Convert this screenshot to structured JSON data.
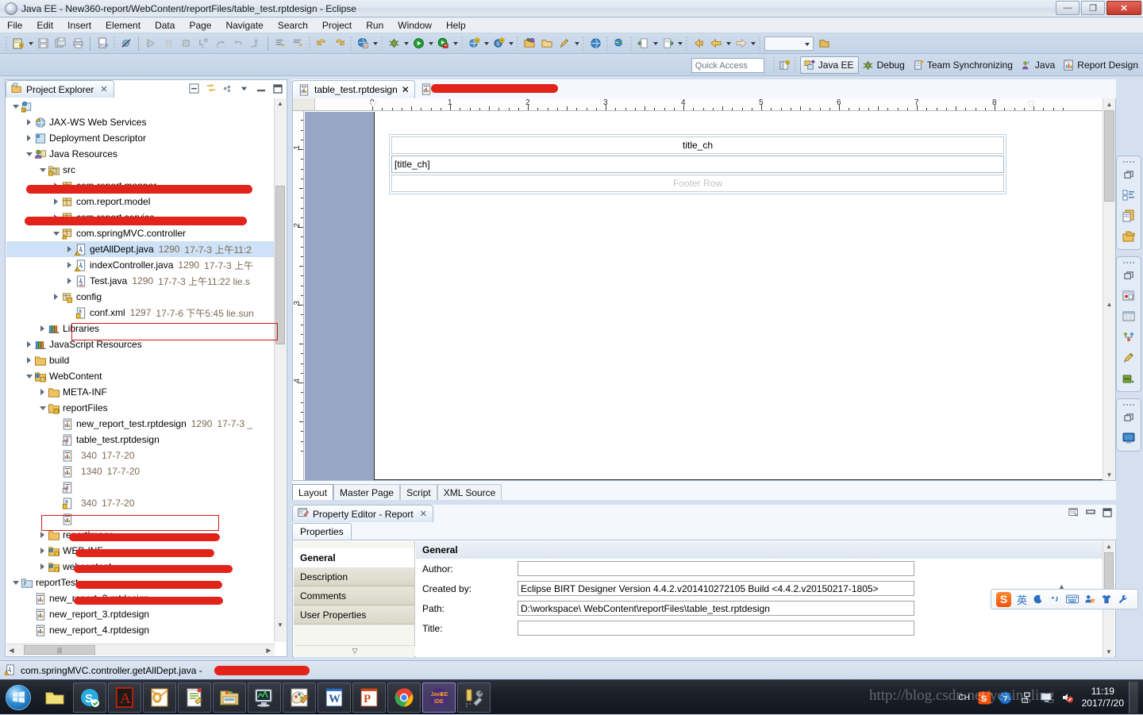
{
  "window": {
    "title": "Java EE - New360-report/WebContent/reportFiles/table_test.rptdesign - Eclipse",
    "minimize_label": "—",
    "restore_label": "❐",
    "close_label": "✕"
  },
  "menubar": {
    "items": [
      "File",
      "Edit",
      "Insert",
      "Element",
      "Data",
      "Page",
      "Navigate",
      "Search",
      "Project",
      "Run",
      "Window",
      "Help"
    ]
  },
  "toolbar": {
    "icons": [
      "new-wizard-icon",
      "save-icon",
      "save-all-icon",
      "print-icon",
      "binary-file-icon",
      "skip-breakpoints-icon",
      "run-icon",
      "suspend-icon",
      "terminate-icon",
      "step-into-icon",
      "step-over-icon",
      "step-return-icon",
      "drop-to-frame-icon",
      "next-annotation-icon",
      "previous-annotation-icon",
      "back-icon",
      "forward-icon",
      "open-web-browser-icon",
      "debug-icon",
      "run-as-icon",
      "run-server-icon",
      "new-web-project-icon",
      "new-server-icon",
      "open-type-icon",
      "open-task-icon",
      "new-report-icon",
      "publish-icon",
      "launch-icon",
      "export-icon",
      "import-icon",
      "previous-edit-icon",
      "back-nav-icon",
      "forward-nav-icon"
    ]
  },
  "perspective_bar": {
    "quick_access_placeholder": "Quick Access",
    "open_perspective_icon": "open-perspective-icon",
    "items": [
      {
        "label": "Java EE",
        "icon": "java-ee-perspective-icon",
        "active": true
      },
      {
        "label": "Debug",
        "icon": "debug-perspective-icon",
        "active": false
      },
      {
        "label": "Team Synchronizing",
        "icon": "team-sync-perspective-icon",
        "active": false
      },
      {
        "label": "Java",
        "icon": "java-perspective-icon",
        "active": false
      },
      {
        "label": "Report Design",
        "icon": "report-design-perspective-icon",
        "active": false
      }
    ]
  },
  "project_explorer": {
    "tab_label": "Project Explorer",
    "close_label": "✕",
    "tools": [
      "collapse-all-icon",
      "link-with-editor-icon",
      "view-menu-icon",
      "minimize-icon",
      "maximize-icon"
    ],
    "tree": [
      {
        "indent": 0,
        "twist": "open",
        "icon": "web-project-icon",
        "label": "",
        "meta": "",
        "meta2": "",
        "redacted": true
      },
      {
        "indent": 1,
        "twist": "closed",
        "icon": "jaxws-icon",
        "label": "JAX-WS Web Services",
        "meta": "",
        "meta2": ""
      },
      {
        "indent": 1,
        "twist": "closed",
        "icon": "deployment-icon",
        "label": "Deployment Descriptor",
        "meta": "",
        "meta2": "",
        "redacted": true
      },
      {
        "indent": 1,
        "twist": "open",
        "icon": "java-resources-icon",
        "label": "Java Resources",
        "meta": "",
        "meta2": ""
      },
      {
        "indent": 2,
        "twist": "open",
        "icon": "source-folder-icon",
        "label": "src",
        "meta": "",
        "meta2": ""
      },
      {
        "indent": 3,
        "twist": "closed",
        "icon": "package-icon",
        "label": "com.report.mapper",
        "meta": "",
        "meta2": ""
      },
      {
        "indent": 3,
        "twist": "closed",
        "icon": "package-icon",
        "label": "com.report.model",
        "meta": "",
        "meta2": ""
      },
      {
        "indent": 3,
        "twist": "closed",
        "icon": "package-warn-icon",
        "label": "com.report.service",
        "meta": "",
        "meta2": ""
      },
      {
        "indent": 3,
        "twist": "open",
        "icon": "package-warn-icon",
        "label": "com.springMVC.controller",
        "meta": "",
        "meta2": ""
      },
      {
        "indent": 4,
        "twist": "closed",
        "icon": "java-warn-icon",
        "label": "getAllDept.java",
        "meta": "1290",
        "meta2": "17-7-3 上午11:2",
        "selected": true,
        "highlight": true
      },
      {
        "indent": 4,
        "twist": "closed",
        "icon": "java-warn-icon",
        "label": "indexController.java",
        "meta": "1290",
        "meta2": "17-7-3 上午"
      },
      {
        "indent": 4,
        "twist": "closed",
        "icon": "java-icon",
        "label": "Test.java",
        "meta": "1290",
        "meta2": "17-7-3 上午11:22  lie.s"
      },
      {
        "indent": 3,
        "twist": "closed",
        "icon": "config-folder-icon",
        "label": "config",
        "meta": "",
        "meta2": ""
      },
      {
        "indent": 4,
        "twist": "none",
        "icon": "xml-icon",
        "label": "conf.xml",
        "meta": "1297",
        "meta2": "17-7-6 下午5:45  lie.sun"
      },
      {
        "indent": 2,
        "twist": "closed",
        "icon": "library-icon",
        "label": "Libraries",
        "meta": "",
        "meta2": ""
      },
      {
        "indent": 1,
        "twist": "closed",
        "icon": "library-icon",
        "label": "JavaScript Resources",
        "meta": "",
        "meta2": ""
      },
      {
        "indent": 1,
        "twist": "closed",
        "icon": "folder-icon",
        "label": "build",
        "meta": "",
        "meta2": ""
      },
      {
        "indent": 1,
        "twist": "open",
        "icon": "webcontent-icon",
        "label": "WebContent",
        "meta": "",
        "meta2": ""
      },
      {
        "indent": 2,
        "twist": "closed",
        "icon": "folder-icon",
        "label": "META-INF",
        "meta": "",
        "meta2": ""
      },
      {
        "indent": 2,
        "twist": "open",
        "icon": "folder-warn-icon",
        "label": "reportFiles",
        "meta": "",
        "meta2": ""
      },
      {
        "indent": 3,
        "twist": "none",
        "icon": "rptdesign-icon",
        "label": "new_report_test.rptdesign",
        "meta": "1290",
        "meta2": "17-7-3 _"
      },
      {
        "indent": 3,
        "twist": "none",
        "icon": "rptdesign-q-icon",
        "label": "table_test.rptdesign",
        "meta": "",
        "meta2": "",
        "highlight": true
      },
      {
        "indent": 3,
        "twist": "none",
        "icon": "rptdesign-icon",
        "label": "",
        "meta": "340",
        "meta2": "17-7-20",
        "redacted": true
      },
      {
        "indent": 3,
        "twist": "none",
        "icon": "rptdesign-icon",
        "label": "",
        "meta": "1340",
        "meta2": "17-7-20",
        "redacted": true
      },
      {
        "indent": 3,
        "twist": "none",
        "icon": "rptdesign-q-icon",
        "label": "",
        "meta": "",
        "meta2": "",
        "redacted": true
      },
      {
        "indent": 3,
        "twist": "none",
        "icon": "xml-icon",
        "label": "",
        "meta": "340",
        "meta2": "17-7-20",
        "redacted": true
      },
      {
        "indent": 3,
        "twist": "none",
        "icon": "rptdesign-icon",
        "label": "",
        "meta": "",
        "meta2": "",
        "redacted": true
      },
      {
        "indent": 2,
        "twist": "closed",
        "icon": "folder-icon",
        "label": "reportImage",
        "meta": "",
        "meta2": ""
      },
      {
        "indent": 2,
        "twist": "closed",
        "icon": "webinf-icon",
        "label": "WEB-INF",
        "meta": "",
        "meta2": ""
      },
      {
        "indent": 2,
        "twist": "closed",
        "icon": "webinf-icon",
        "label": "webcontent",
        "meta": "",
        "meta2": ""
      },
      {
        "indent": 0,
        "twist": "open",
        "icon": "project-icon",
        "label": "reportTest",
        "meta": "",
        "meta2": ""
      },
      {
        "indent": 1,
        "twist": "none",
        "icon": "rptdesign-icon",
        "label": "new_report_2.rptdesign",
        "meta": "",
        "meta2": ""
      },
      {
        "indent": 1,
        "twist": "none",
        "icon": "rptdesign-icon",
        "label": "new_report_3.rptdesign",
        "meta": "",
        "meta2": ""
      },
      {
        "indent": 1,
        "twist": "none",
        "icon": "rptdesign-icon",
        "label": "new_report_4.rptdesign",
        "meta": "",
        "meta2": ""
      }
    ]
  },
  "editor": {
    "tabs": [
      {
        "label": "table_test.rptdesign",
        "icon": "rptdesign-icon",
        "active": true,
        "close_label": "✕"
      },
      {
        "label": "",
        "icon": "rptdesign-icon",
        "active": false,
        "redacted": true
      }
    ],
    "ruler": {
      "horizontal_numbers": [
        "0",
        "1",
        "2",
        "3",
        "4",
        "5",
        "6",
        "7",
        "8"
      ],
      "vertical_numbers": [
        "1",
        "2",
        "3",
        "4"
      ]
    },
    "report": {
      "header_row_text": "title_ch",
      "detail_row_text": "[title_ch]",
      "footer_row_text": "Footer Row"
    },
    "page_tabs": [
      {
        "label": "Layout",
        "mnemonic": "y",
        "active": true
      },
      {
        "label": "Master Page",
        "mnemonic": "M",
        "active": false
      },
      {
        "label": "Script",
        "mnemonic": "S",
        "active": false
      },
      {
        "label": "XML Source",
        "mnemonic": "X",
        "active": false
      }
    ]
  },
  "property_editor": {
    "tab_label": "Property Editor - Report",
    "tab_icon": "property-editor-icon",
    "close_label": "✕",
    "tools": [
      "restore-icon",
      "minimize-icon",
      "maximize-icon"
    ],
    "sub_tab": "Properties",
    "categories": [
      {
        "label": "General",
        "active": true
      },
      {
        "label": "Description",
        "active": false
      },
      {
        "label": "Comments",
        "active": false
      },
      {
        "label": "User Properties",
        "active": false
      }
    ],
    "section_title": "General",
    "fields": [
      {
        "label": "Author:",
        "mnemonic": "u",
        "value": ""
      },
      {
        "label": "Created by:",
        "mnemonic": "C",
        "value": "Eclipse BIRT Designer Version 4.4.2.v201410272105 Build <4.4.2.v20150217-1805>"
      },
      {
        "label": "Path:",
        "mnemonic": "P",
        "value": "D:\\workspace\\            WebContent\\reportFiles\\table_test.rptdesign"
      },
      {
        "label": "Title:",
        "mnemonic": "T",
        "value": ""
      }
    ]
  },
  "palette_strip": {
    "groups": [
      {
        "icons": [
          "restore-icon",
          "outline-view-icon",
          "data-explorer-icon",
          "resource-explorer-icon"
        ]
      },
      {
        "icons": [
          "restore-icon",
          "palette-view-icon",
          "cheatsheet-icon",
          "navigator-icon",
          "snippets-icon",
          "servers-icon"
        ]
      },
      {
        "icons": [
          "restore-icon",
          "console-view-icon"
        ]
      }
    ]
  },
  "status_bar": {
    "icon": "java-warn-icon",
    "text": "com.springMVC.controller.getAllDept.java - ",
    "redacted_suffix": true
  },
  "ime": {
    "logo": "S",
    "buttons": [
      "英",
      "moon-icon",
      "comma-icon",
      "keyboard-icon",
      "toolbox-icon",
      "skin-icon",
      "settings-icon"
    ]
  },
  "taskbar": {
    "start_label": "⊞",
    "apps": [
      {
        "name": "explorer-folder-icon",
        "framed": false
      },
      {
        "name": "skype-icon",
        "framed": true
      },
      {
        "name": "adobe-reader-icon",
        "framed": true
      },
      {
        "name": "outlook-icon",
        "framed": true
      },
      {
        "name": "notepad-icon",
        "framed": true
      },
      {
        "name": "file-manager-icon",
        "framed": true
      },
      {
        "name": "monitor-tool-icon",
        "framed": true
      },
      {
        "name": "paint-icon",
        "framed": true
      },
      {
        "name": "word-icon",
        "framed": true
      },
      {
        "name": "powerpoint-icon",
        "framed": true
      },
      {
        "name": "chrome-icon",
        "framed": true
      },
      {
        "name": "eclipse-java-ee-icon",
        "framed": true,
        "active": true
      },
      {
        "name": "tools-icon",
        "framed": true
      }
    ],
    "tray": [
      "CH",
      "sogou-icon",
      "help-icon",
      "network-icon",
      "display-icon",
      "volume-mute-icon"
    ],
    "clock_time": "11:19",
    "clock_date": "2017/7/20"
  },
  "watermark": "http://blog.csdn.net/yexingling"
}
